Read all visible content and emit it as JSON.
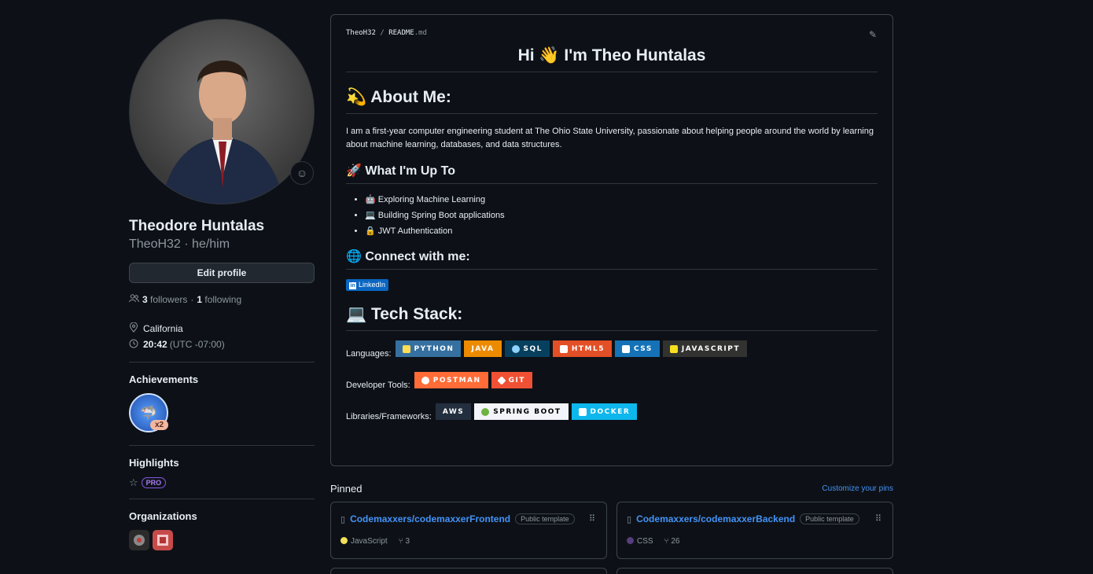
{
  "profile": {
    "full_name": "Theodore Huntalas",
    "username_line": "TheoH32 · he/him",
    "edit_label": "Edit profile",
    "followers_count": "3",
    "followers_label": "followers",
    "sep": "·",
    "following_count": "1",
    "following_label": "following",
    "location": "California",
    "time": "20:42",
    "timezone": "(UTC -07:00)"
  },
  "achievements": {
    "title": "Achievements",
    "badge_multiplier": "x2"
  },
  "highlights": {
    "title": "Highlights",
    "pro_label": "PRO"
  },
  "organizations": {
    "title": "Organizations"
  },
  "readme": {
    "owner": "TheoH32",
    "slash": "/",
    "file_base": "README",
    "file_ext": ".md",
    "hero": "Hi 👋 I'm Theo Huntalas",
    "about_heading": "💫 About Me:",
    "about_text": "I am a first-year computer engineering student at The Ohio State University, passionate about helping people around the world by learning about machine learning, databases, and data structures.",
    "upto_heading": "🚀 What I'm Up To",
    "upto_items": [
      "🤖 Exploring Machine Learning",
      "💻 Building Spring Boot applications",
      "🔒 JWT Authentication"
    ],
    "connect_heading": "🌐 Connect with me:",
    "linkedin_label": "LinkedIn",
    "tech_heading": "💻 Tech Stack:",
    "languages_label": "Languages:",
    "tools_label": "Developer Tools:",
    "libs_label": "Libraries/Frameworks:",
    "languages": [
      {
        "label": "PYTHON",
        "color": "#3670a0",
        "icon": "#ffdd54"
      },
      {
        "label": "JAVA",
        "color": "#ed8b00",
        "icon": ""
      },
      {
        "label": "SQL",
        "color": "#07405e",
        "icon": "#8fd2ff"
      },
      {
        "label": "HTML5",
        "color": "#e34f26",
        "icon": "#ffffff"
      },
      {
        "label": "CSS",
        "color": "#1572b6",
        "icon": "#ffffff"
      },
      {
        "label": "JAVASCRIPT",
        "color": "#323330",
        "icon": "#f7df1e"
      }
    ],
    "tools": [
      {
        "label": "POSTMAN",
        "color": "#ff6c37",
        "icon": "#ffffff"
      },
      {
        "label": "GIT",
        "color": "#f05033",
        "icon": "#ffffff"
      }
    ],
    "libs": [
      {
        "label": "AWS",
        "color": "#232f3e",
        "text": "#ffffff",
        "icon": ""
      },
      {
        "label": "SPRING BOOT",
        "color": "#f2f4f9",
        "text": "#000000",
        "icon": "#6db33f"
      },
      {
        "label": "DOCKER",
        "color": "#0db7ed",
        "text": "#ffffff",
        "icon": "#ffffff"
      }
    ]
  },
  "pinned": {
    "title": "Pinned",
    "customize": "Customize your pins",
    "repos": [
      {
        "name": "Codemaxxers/codemaxxerFrontend",
        "pill": "Public template",
        "lang": "JavaScript",
        "lang_color": "#f1e05a",
        "forks": "3"
      },
      {
        "name": "Codemaxxers/codemaxxerBackend",
        "pill": "Public template",
        "lang": "CSS",
        "lang_color": "#563d7c",
        "forks": "26"
      }
    ]
  }
}
